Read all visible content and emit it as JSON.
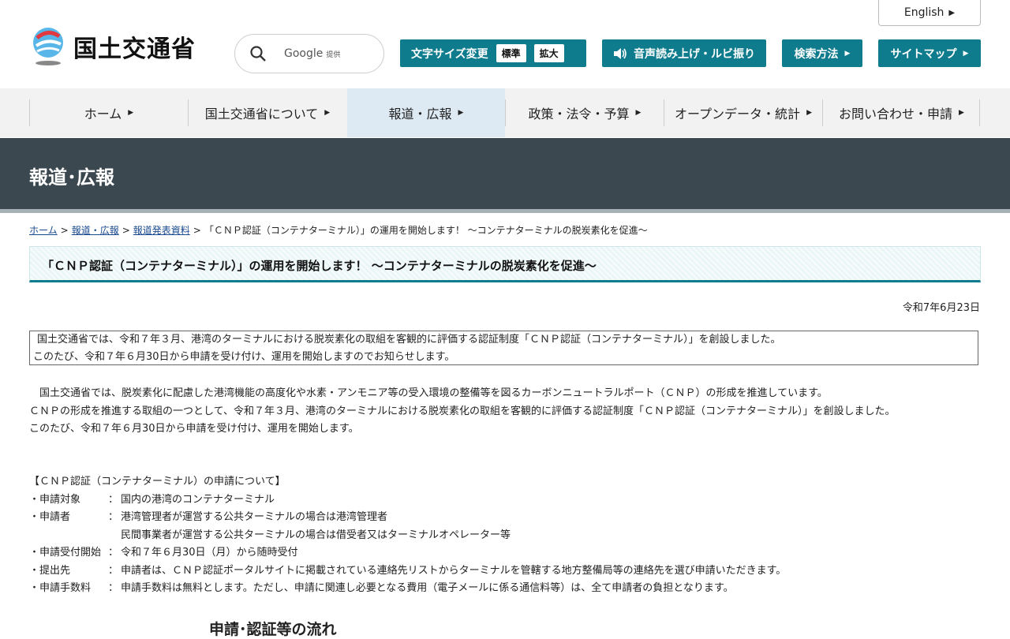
{
  "header": {
    "logo_text": "国土交通省",
    "english": "English",
    "search": {
      "placeholder": "Google",
      "provided": "提供"
    },
    "fontsize": {
      "label": "文字サイズ変更",
      "standard": "標準",
      "large": "拡大"
    },
    "audio_label": "音声読み上げ・ルビ振り",
    "howto_label": "検索方法",
    "sitemap_label": "サイトマップ"
  },
  "nav": {
    "items": [
      {
        "label": "ホーム"
      },
      {
        "label": "国土交通省について"
      },
      {
        "label": "報道・広報"
      },
      {
        "label": "政策・法令・予算"
      },
      {
        "label": "オープンデータ・統計"
      },
      {
        "label": "お問い合わせ・申請"
      }
    ]
  },
  "banner": {
    "title": "報道･広報"
  },
  "breadcrumb": {
    "home": "ホーム",
    "press": "報道・広報",
    "releases": "報道発表資料",
    "current": "「ＣＮＰ認証（コンテナターミナル）」の運用を開始します！ ～コンテナターミナルの脱炭素化を促進～",
    "sep": ">"
  },
  "article": {
    "title": "「ＣＮＰ認証（コンテナターミナル）」の運用を開始します！ ～コンテナターミナルの脱炭素化を促進～",
    "date": "令和7年6月23日",
    "summary": [
      "国土交通省では、令和７年３月、港湾のターミナルにおける脱炭素化の取組を客観的に評価する認証制度「ＣＮＰ認証（コンテナターミナル）」を創設しました。",
      "このたび、令和７年６月30日から申請を受け付け、運用を開始しますのでお知らせします。"
    ],
    "body": [
      "　国土交通省では、脱炭素化に配慮した港湾機能の高度化や水素・アンモニア等の受入環境の整備等を図るカーボンニュートラルポート（ＣＮＰ）の形成を推進しています。",
      "ＣＮＰの形成を推進する取組の一つとして、令和７年３月、港湾のターミナルにおける脱炭素化の取組を客観的に評価する認証制度「ＣＮＰ認証（コンテナターミナル）」を創設しました。",
      "このたび、令和７年６月30日から申請を受け付け、運用を開始します。"
    ],
    "application": {
      "heading": "【ＣＮＰ認証（コンテナターミナル）の申請について】",
      "target_key": "・申請対象",
      "target_val": "国内の港湾のコンテナターミナル",
      "applicant_key": "・申請者",
      "applicant_val1": "港湾管理者が運営する公共ターミナルの場合は港湾管理者",
      "applicant_val2": "民間事業者が運営する公共ターミナルの場合は借受者又はターミナルオペレーター等",
      "start_key": "・申請受付開始",
      "start_val": "令和７年６月30日（月）から随時受付",
      "submit_key": "・提出先",
      "submit_val": "申請者は、ＣＮＰ認証ポータルサイトに掲載されている連絡先リストからターミナルを管轄する地方整備局等の連絡先を選び申請いただきます。",
      "fee_key": "・申請手数料",
      "fee_val": "申請手数料は無料とします。ただし、申請に関連し必要となる費用（電子メールに係る通信料等）は、全て申請者の負担となります。",
      "colon": "："
    },
    "flow_title": "申請･認証等の流れ"
  }
}
